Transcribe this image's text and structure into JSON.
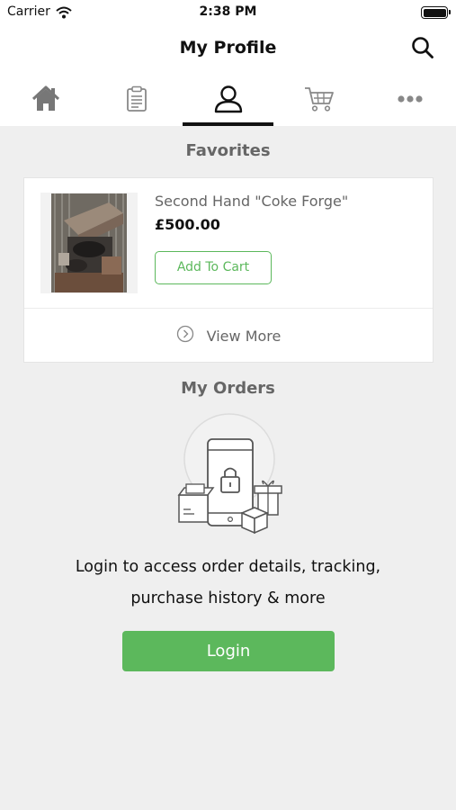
{
  "status_bar": {
    "carrier": "Carrier",
    "time": "2:38 PM"
  },
  "header": {
    "title": "My Profile"
  },
  "tabs": [
    {
      "icon": "home-icon"
    },
    {
      "icon": "clipboard-icon"
    },
    {
      "icon": "profile-icon",
      "active": true
    },
    {
      "icon": "cart-icon"
    },
    {
      "icon": "more-icon"
    }
  ],
  "favorites": {
    "title": "Favorites",
    "items": [
      {
        "name": "Second Hand \"Coke Forge\"",
        "price": "£500.00",
        "button_label": "Add To Cart"
      }
    ],
    "view_more_label": "View More"
  },
  "orders": {
    "title": "My Orders",
    "message_line1": "Login to access order details, tracking,",
    "message_line2": "purchase history & more",
    "login_label": "Login"
  },
  "colors": {
    "accent": "#5cb85c",
    "background": "#efefef",
    "text": "#111111",
    "muted": "#666666"
  }
}
